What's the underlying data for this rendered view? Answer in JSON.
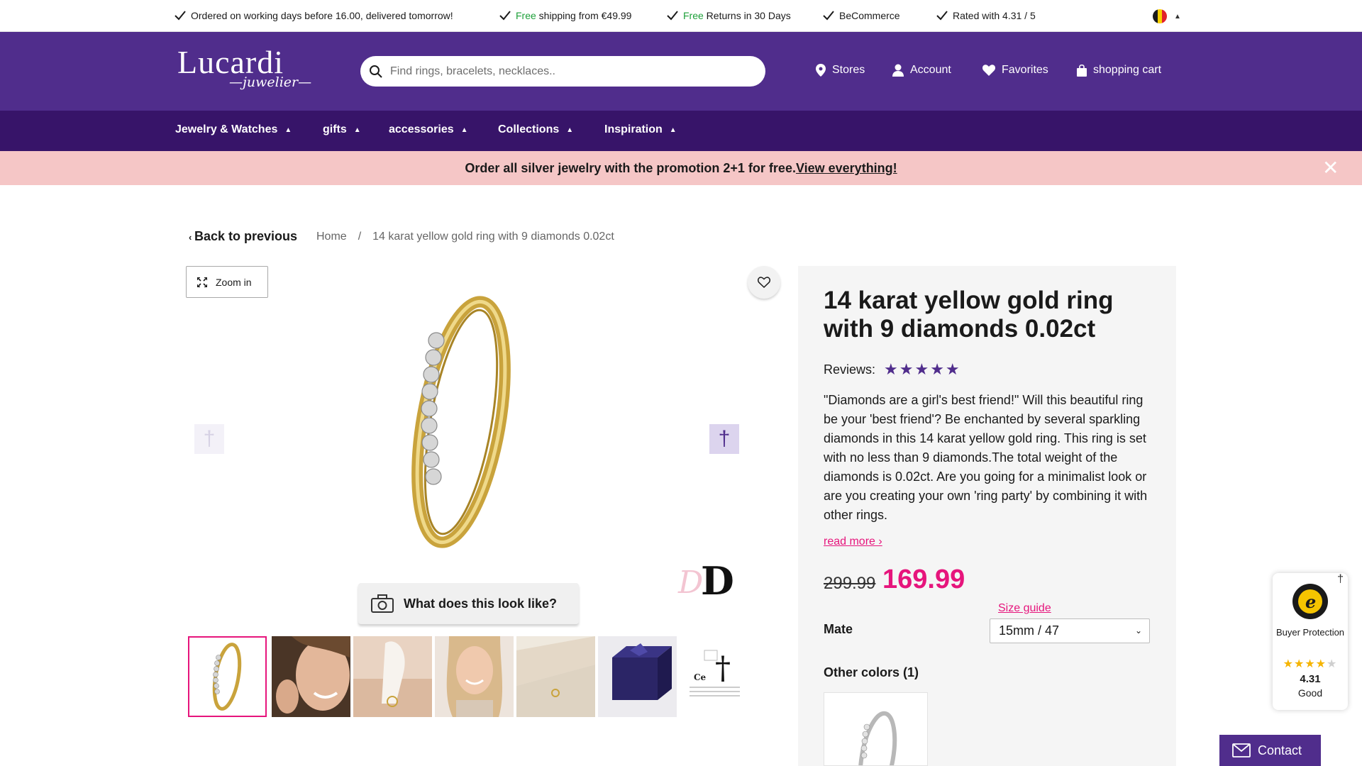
{
  "usp_bar": {
    "items": [
      {
        "highlight": "",
        "text": "Ordered on working days before 16.00, delivered tomorrow!"
      },
      {
        "highlight": "Free",
        "text": " shipping from €49.99"
      },
      {
        "highlight": "Free",
        "text": " Returns in 30 Days"
      },
      {
        "highlight": "",
        "text": "BeCommerce"
      },
      {
        "highlight": "",
        "text": "Rated with 4.31 / 5"
      }
    ],
    "language_flag": "BE"
  },
  "header": {
    "logo_main": "Lucardi",
    "logo_sub": "juwelier",
    "search_placeholder": "Find rings, bracelets, necklaces..",
    "nav": {
      "stores": "Stores",
      "account": "Account",
      "favorites": "Favorites",
      "cart": "shopping cart"
    }
  },
  "category_nav": [
    "Jewelry & Watches",
    "gifts",
    "accessories",
    "Collections",
    "Inspiration"
  ],
  "promo": {
    "text": "Order all silver jewelry with the promotion 2+1 for free.",
    "link": "View everything!"
  },
  "breadcrumb": {
    "back": "Back to previous",
    "home": "Home",
    "separator": "/",
    "current": "14 karat yellow gold ring with 9 diamonds 0.02ct"
  },
  "gallery": {
    "zoom_label": "Zoom in",
    "look_label": "What does this look like?",
    "thumb_count": 7
  },
  "product": {
    "title": "14 karat yellow gold ring with 9 diamonds 0.02ct",
    "reviews_label": "Reviews:",
    "rating_stars": 5,
    "description": "\"Diamonds are a girl's best friend!\" Will this beautiful ring be your 'best friend'? Be enchanted by several sparkling diamonds in this 14 karat yellow gold ring. This ring is set with no less than 9 diamonds.The total weight of the diamonds is 0.02ct. Are you going for a minimalist look or are you creating your own 'ring party' by combining it with other rings.",
    "read_more": "read more ›",
    "old_price": "299.99",
    "price": "169.99",
    "size_guide": "Size guide",
    "size_label": "Mate",
    "size_value": "15mm / 47",
    "other_colors": "Other colors (1)"
  },
  "trusted": {
    "label": "Buyer Protection",
    "score": "4.31",
    "grade": "Good",
    "rating": 4.31
  },
  "contact": {
    "label": "Contact"
  },
  "colors": {
    "brand_purple": "#502d8c",
    "nav_purple": "#371469",
    "accent_pink": "#e6157c",
    "promo_pink": "#f5c6c6",
    "usp_green": "#1ea03a"
  }
}
